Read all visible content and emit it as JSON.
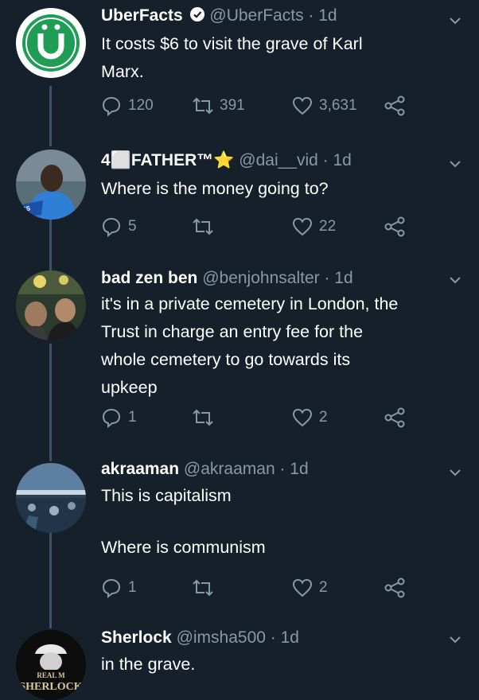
{
  "tweets": [
    {
      "name": "UberFacts",
      "verified": true,
      "handle": "@UberFacts",
      "time": "· 1d",
      "text": [
        "It costs $6 to visit the grave of Karl",
        "Marx."
      ],
      "replies": "120",
      "retweets": "391",
      "likes": "3,631",
      "avatar_icon": "uberfacts-logo"
    },
    {
      "name": "4⬜FATHER™⭐",
      "handle": "@dai__vid",
      "time": "· 1d",
      "text": [
        "Where is the money going to?"
      ],
      "replies": "5",
      "retweets": "",
      "likes": "22",
      "avatar_icon": "person-photo"
    },
    {
      "name": "bad zen ben",
      "handle": "@benjohnsalter",
      "time": "· 1d",
      "text": [
        "it's in a private cemetery in London, the",
        "Trust in charge an entry fee for the",
        "whole cemetery to go towards its",
        "upkeep"
      ],
      "replies": "1",
      "retweets": "",
      "likes": "2",
      "avatar_icon": "crowd-photo"
    },
    {
      "name": "akraaman",
      "handle": "@akraaman",
      "time": "· 1d",
      "text": [
        "This is capitalism",
        "",
        "Where is communism"
      ],
      "replies": "1",
      "retweets": "",
      "likes": "2",
      "avatar_icon": "stadium-photo"
    },
    {
      "name": "Sherlock",
      "handle": "@imsha500",
      "time": "· 1d",
      "text": [
        "in the grave."
      ],
      "avatar_icon": "sherlock-logo",
      "avatar_text": [
        "REAL M",
        "SHERLOCK"
      ]
    }
  ],
  "colors": {
    "bg": "#15202b",
    "muted": "#8899a6",
    "uber_green": "#1f9d55"
  }
}
